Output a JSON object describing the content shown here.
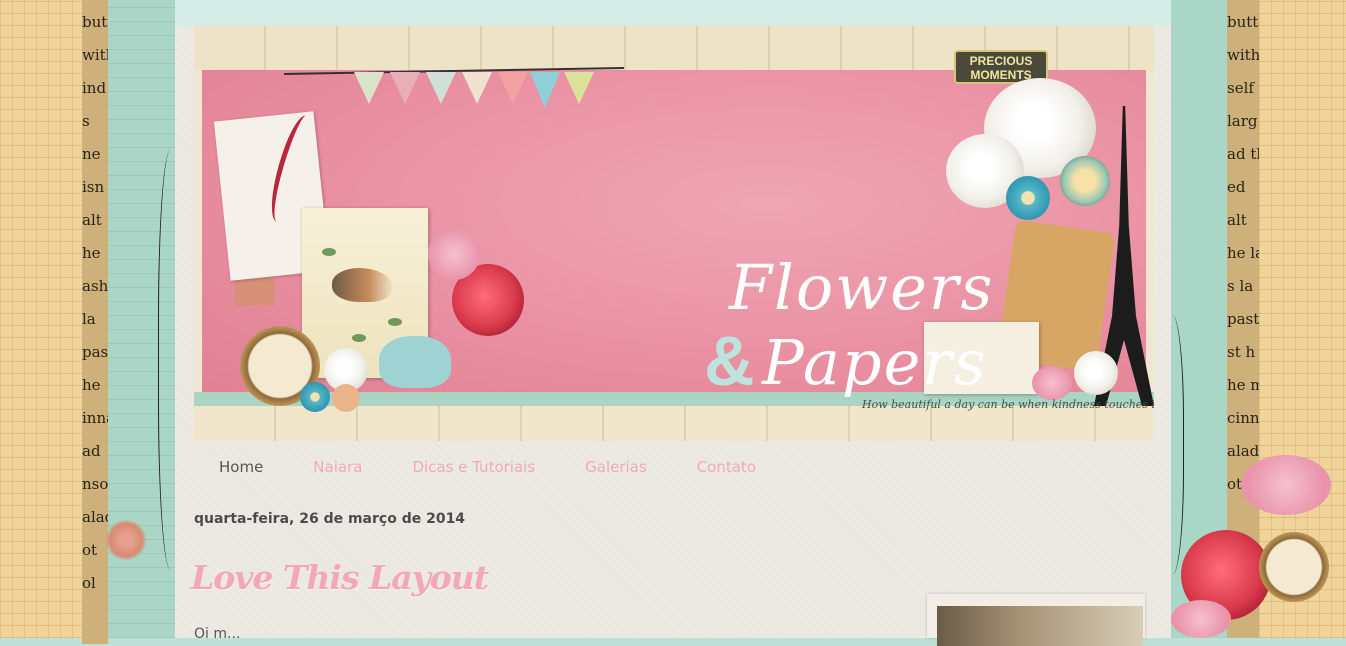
{
  "header": {
    "badge_line1": "PRECIOUS",
    "badge_line2": "MOMENTS",
    "logo_line1": "Flowers",
    "logo_amp": "&",
    "logo_line2": "Papers",
    "tagline": "How beautiful a day can be when kindness touches it!"
  },
  "nav": {
    "items": [
      {
        "label": "Home",
        "active": true
      },
      {
        "label": "Naiara",
        "active": false
      },
      {
        "label": "Dicas e Tutoriais",
        "active": false
      },
      {
        "label": "Galerias",
        "active": false
      },
      {
        "label": "Contato",
        "active": false
      }
    ]
  },
  "post": {
    "date": "quarta-feira, 26 de março de 2014",
    "title": "Love This Layout",
    "text_start": "Oi m..."
  },
  "decor": {
    "left_words": [
      "butte",
      "with",
      "ind",
      "s",
      "ne",
      "isn",
      "alt",
      "he",
      "ashed",
      "la",
      "pas",
      "he",
      "innat",
      "ad",
      "nso",
      "alad",
      "ot",
      "ol"
    ],
    "right_words": [
      "butte",
      "with",
      "self",
      "larg",
      "ad th",
      "ed",
      "alt",
      "he la",
      "s la",
      "pasto",
      "st h",
      "he m",
      "cinna",
      "alado",
      "ot"
    ],
    "colors": {
      "accent_pink": "#f2a9b7",
      "banner_pink": "#e88ea0",
      "mint": "#a9d6c6",
      "text_gray": "#4c4c4c"
    }
  }
}
